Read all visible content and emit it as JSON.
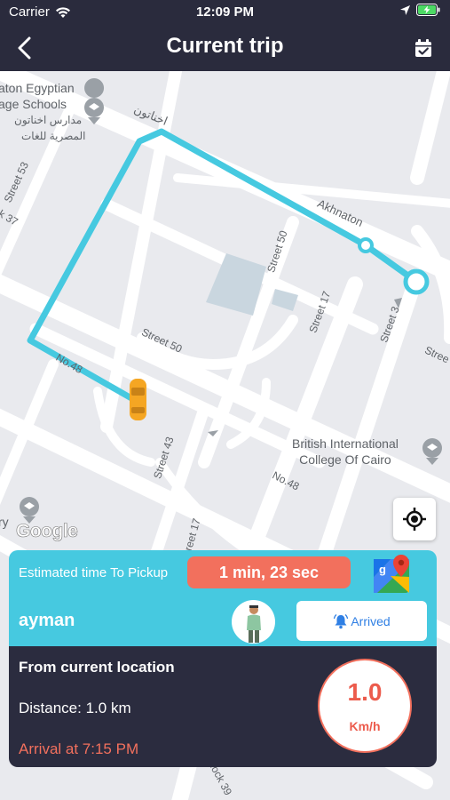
{
  "status_bar": {
    "carrier": "Carrier",
    "time": "12:09 PM"
  },
  "header": {
    "title": "Current trip",
    "back_icon": "chevron-left-icon",
    "calendar_icon": "calendar-check-icon"
  },
  "map": {
    "streets": [
      {
        "id": "akhnaton",
        "text": "Akhnaton"
      },
      {
        "id": "akhnaton-ar",
        "text": "اخناتون"
      },
      {
        "id": "street50-a",
        "text": "Street 50"
      },
      {
        "id": "street50-b",
        "text": "Street 50"
      },
      {
        "id": "street17-a",
        "text": "Street 17"
      },
      {
        "id": "street3",
        "text": "Street 3"
      },
      {
        "id": "street53",
        "text": "Street 53"
      },
      {
        "id": "no48-a",
        "text": "No.48"
      },
      {
        "id": "no48-b",
        "text": "No.48"
      },
      {
        "id": "street43",
        "text": "Street 43"
      },
      {
        "id": "street37",
        "text": "k 37"
      },
      {
        "id": "street17-b",
        "text": "treet 17"
      },
      {
        "id": "block39",
        "text": "lock 39"
      },
      {
        "id": "stree-r",
        "text": "Stree"
      }
    ],
    "poi_school": {
      "line1": "aton Egyptian",
      "line2": "age Schools",
      "line3": "مدارس اخناتون",
      "line4": "المصرية للغات"
    },
    "poi_college": {
      "line1": "British International",
      "line2": "College Of Cairo"
    },
    "poi_left": {
      "line1": "ry"
    },
    "google_logo": "Google",
    "route_color": "#46c9e0",
    "locate_icon": "crosshair-icon"
  },
  "trip_card": {
    "eta_label": "Estimated time To Pickup",
    "eta_value": "1 min, 23 sec",
    "maps_icon": "google-maps-icon",
    "driver_name": "ayman",
    "arrived_label": "Arrived",
    "arrived_icon": "bell-icon",
    "from_label": "From current location",
    "distance": "Distance: 1.0 km",
    "arrival": "Arrival at 7:15 PM",
    "speed_value": "1.0",
    "speed_unit": "Km/h",
    "accent_color": "#f2705d",
    "panel_color": "#46c9e0"
  }
}
